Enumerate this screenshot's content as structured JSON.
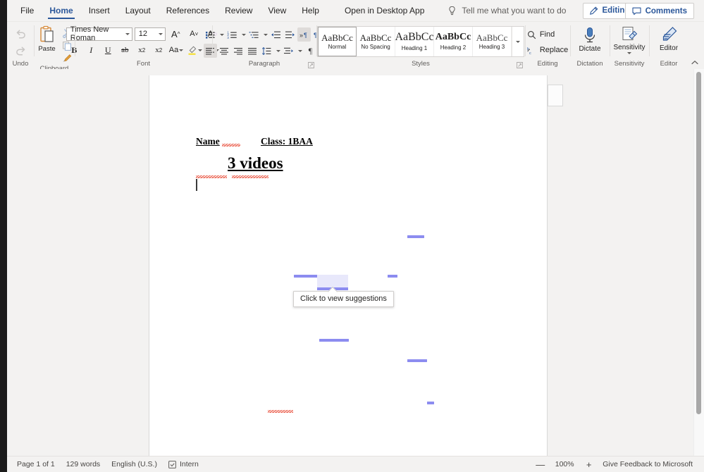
{
  "topbar": {
    "menu": [
      {
        "label": "File",
        "active": false
      },
      {
        "label": "Home",
        "active": true
      },
      {
        "label": "Insert",
        "active": false
      },
      {
        "label": "Layout",
        "active": false
      },
      {
        "label": "References",
        "active": false
      },
      {
        "label": "Review",
        "active": false
      },
      {
        "label": "View",
        "active": false
      },
      {
        "label": "Help",
        "active": false
      }
    ],
    "open_desktop": "Open in Desktop App",
    "tell_me": "Tell me what you want to do",
    "editing_label": "Editing",
    "comments_label": "Comments"
  },
  "ribbon": {
    "groups": {
      "undo": "Undo",
      "clipboard": "Clipboard",
      "font": "Font",
      "paragraph": "Paragraph",
      "styles": "Styles",
      "editing": "Editing",
      "dictation": "Dictation",
      "sensitivity": "Sensitivity",
      "editor": "Editor"
    },
    "paste_label": "Paste",
    "font_name": "Times New Roman",
    "font_size": "12",
    "font_buttons": {
      "bold": "B",
      "italic": "I",
      "underline": "U",
      "strikethrough": "ab",
      "subscript": "x",
      "superscript": "x",
      "change_case": "Aa",
      "highlight": "highlight",
      "font_color": "A"
    },
    "styles": [
      {
        "preview": "AaBbCc",
        "name": "Normal",
        "selected": true
      },
      {
        "preview": "AaBbCc",
        "name": "No Spacing",
        "selected": false
      },
      {
        "preview": "AaBbCc",
        "name": "Heading 1",
        "selected": false
      },
      {
        "preview": "AaBbCc",
        "name": "Heading 2",
        "selected": false
      },
      {
        "preview": "AaBbCc",
        "name": "Heading 3",
        "selected": false
      }
    ],
    "find_label": "Find",
    "replace_label": "Replace",
    "dictate_label": "Dictate",
    "sensitivity_label": "Sensitivity",
    "editor_label": "Editor"
  },
  "document": {
    "name_field": "Name",
    "class_field": "Class: 1BAA",
    "title": "3 videos",
    "tooltip": "Click to view suggestions"
  },
  "statusbar": {
    "page": "Page 1 of 1",
    "words": "129 words",
    "language": "English (U.S.)",
    "mode": "Intern",
    "zoom": "100%",
    "zoom_out": "—",
    "zoom_in": "+",
    "feedback": "Give Feedback to Microsoft"
  },
  "colors": {
    "accent": "#2b579a",
    "ribbon_bg": "#f3f2f1",
    "canvas_bg": "#f3f2f1",
    "spell_error": "#e8402a",
    "suggestion_blue": "#8c8cf0"
  }
}
